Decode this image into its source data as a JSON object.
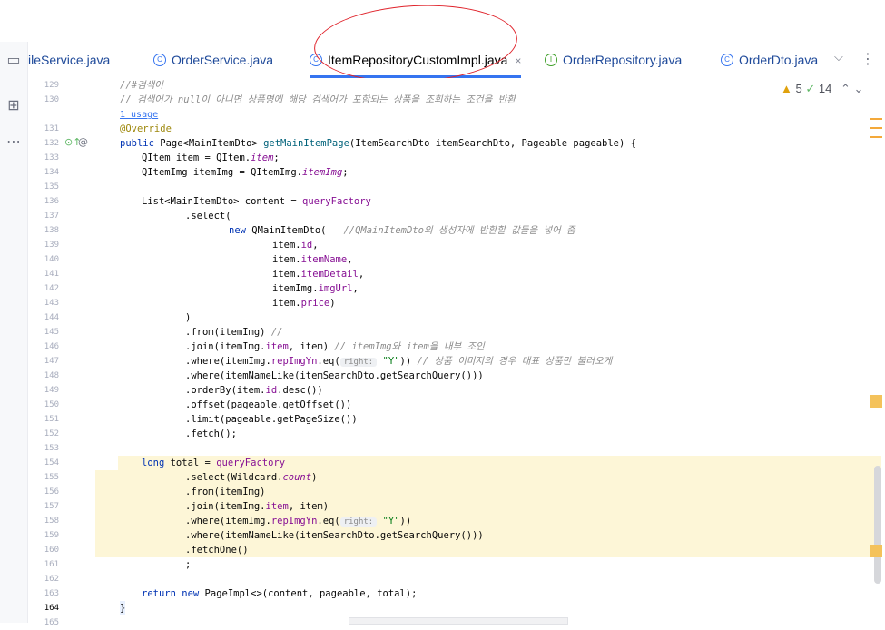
{
  "tabs": [
    {
      "label": "ileService.java",
      "icon": "class-icon",
      "active": false
    },
    {
      "label": "OrderService.java",
      "icon": "class-icon",
      "active": false
    },
    {
      "label": "ItemRepositoryCustomImpl.java",
      "icon": "class-icon",
      "active": true,
      "close": "×"
    },
    {
      "label": "OrderRepository.java",
      "icon": "interface-icon",
      "active": false
    },
    {
      "label": "OrderDto.java",
      "icon": "class-icon",
      "active": false
    }
  ],
  "inspections": {
    "warnings": "5",
    "passed": "14"
  },
  "gutter": {
    "line_numbers": [
      "129",
      "130",
      "",
      "131",
      "132",
      "133",
      "134",
      "135",
      "136",
      "137",
      "138",
      "139",
      "140",
      "141",
      "142",
      "143",
      "144",
      "145",
      "146",
      "147",
      "148",
      "149",
      "150",
      "151",
      "152",
      "153",
      "154",
      "155",
      "156",
      "157",
      "158",
      "159",
      "160",
      "161",
      "162",
      "163",
      "164",
      "165"
    ]
  },
  "code": {
    "l129": "//#검색어",
    "l130": "// 검색어가 null이 아니면 상품명에 해당 검색어가 포함되는 상품을 조회하는 조건을 반환",
    "usage": "1 usage",
    "l131": "@Override",
    "l132a": "public ",
    "l132b": "Page<MainItemDto> ",
    "l132c": "getMainItemPage",
    "l132d": "(ItemSearchDto itemSearchDto, Pageable pageable) {",
    "l133": "QItem item = QItem.",
    "l133f": "item",
    "l134": "QItemImg itemImg = QItemImg.",
    "l134f": "itemImg",
    "l136a": "List<MainItemDto> content = ",
    "l136f": "queryFactory",
    "l137": ".select(",
    "l138a": "new ",
    "l138b": "QMainItemDto(   ",
    "l138c": "//QMainItemDto의 생성자에 반환할 값들을 넣어 줌",
    "l139": "item.",
    "l139f": "id",
    "l140f": "itemName",
    "l141f": "itemDetail",
    "l142": "itemImg.",
    "l142f": "imgUrl",
    "l143f": "price",
    "l144": ")",
    "l145": ".from(itemImg) ",
    "l145c": "//",
    "l146a": ".join(itemImg.",
    "l146f": "item",
    "l146b": ", item) ",
    "l146c": "// itemImg와 item을 내부 조인",
    "l147a": ".where(itemImg.",
    "l147f": "repImgYn",
    "l147b": ".eq(",
    "hint": "right:",
    "l147s": "\"Y\"",
    "l147d": ")) ",
    "l147c": "// 상품 이미지의 경우 대표 상품만 불러오게",
    "l148": ".where(itemNameLike(itemSearchDto.getSearchQuery()))",
    "l149a": ".orderBy(item.",
    "l149f": "id",
    "l149b": ".desc())",
    "l150": ".offset(pageable.getOffset())",
    "l151": ".limit(pageable.getPageSize())",
    "l152": ".fetch();",
    "l154a": "long ",
    "l154b": "total = ",
    "l154f": "queryFactory",
    "l155a": ".select(Wildcard.",
    "l155f": "count",
    "l155b": ")",
    "l156": ".from(itemImg)",
    "l157a": ".join(itemImg.",
    "l157f": "item",
    "l157b": ", item)",
    "l158a": ".where(itemImg.",
    "l158f": "repImgYn",
    "l158b": ".eq(",
    "l158s": "\"Y\"",
    "l158d": "))",
    "l159": ".where(itemNameLike(itemSearchDto.getSearchQuery()))",
    "l160": ".fetchOne()",
    "l161": ";",
    "l163a": "return new ",
    "l163b": "PageImpl<>(content, pageable, total);",
    "l164": "}"
  },
  "colors": {
    "accent": "#3574f0",
    "annotation_circle": "#e0242c",
    "highlight": "#fdf6d7"
  }
}
